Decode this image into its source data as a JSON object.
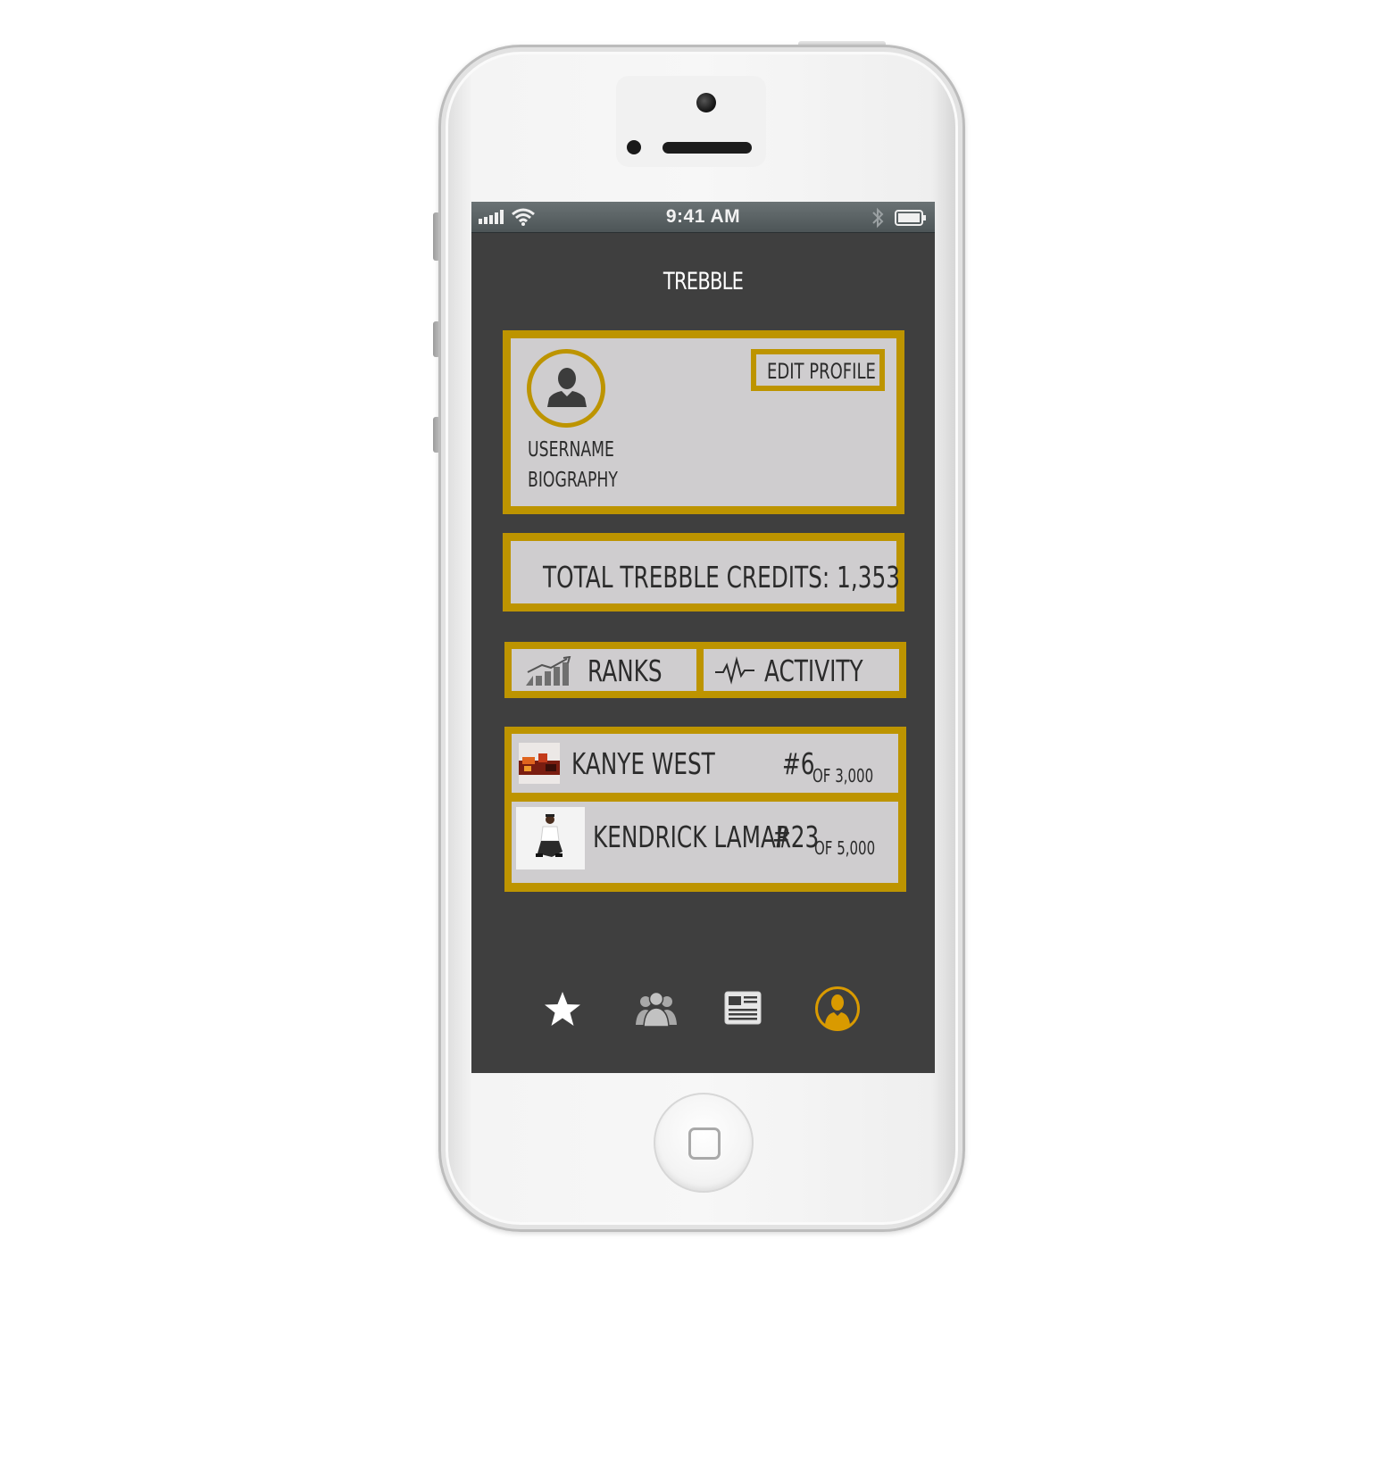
{
  "status_bar": {
    "time": "9:41 AM"
  },
  "app": {
    "title": "TREBBLE"
  },
  "profile": {
    "username": "USERNAME",
    "biography": "BIOGRAPHY",
    "edit_label": "EDIT PROFILE"
  },
  "credits": {
    "label": "TOTAL TREBBLE CREDITS: 1,353"
  },
  "tabs": [
    {
      "label": "RANKS",
      "icon": "ranks-chart-icon"
    },
    {
      "label": "ACTIVITY",
      "icon": "activity-pulse-icon"
    }
  ],
  "ranks": [
    {
      "artist": "KANYE WEST",
      "rank": "#6",
      "of": "OF 3,000",
      "thumbnail": "kanye-west-thumbnail"
    },
    {
      "artist": "KENDRICK LAMAR",
      "rank": "#23",
      "of": "OF 5,000",
      "thumbnail": "kendrick-lamar-thumbnail"
    }
  ],
  "bottom_nav": [
    {
      "icon": "star-icon",
      "active": false
    },
    {
      "icon": "people-icon",
      "active": false
    },
    {
      "icon": "newspaper-icon",
      "active": false
    },
    {
      "icon": "profile-icon",
      "active": true
    }
  ],
  "colors": {
    "accent": "#bd9400",
    "screen_background": "#3f3f3f",
    "card_background": "#cfcdcf",
    "text": "#2b2b2b"
  }
}
